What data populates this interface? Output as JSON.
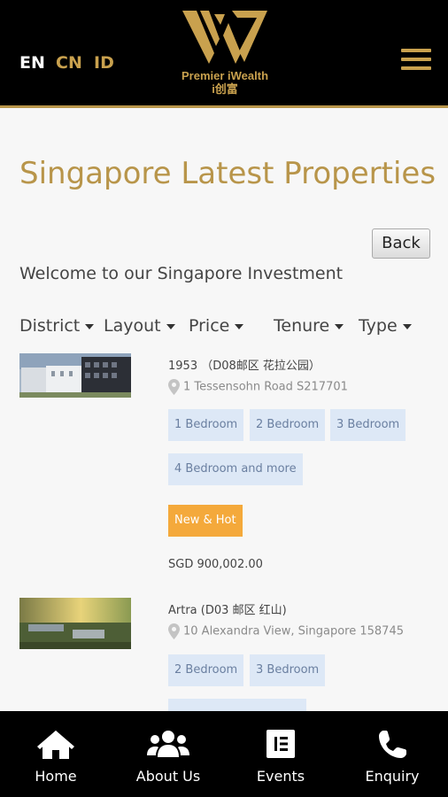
{
  "header": {
    "languages": [
      "EN",
      "CN",
      "ID"
    ],
    "logo_text": "Premier iWealth",
    "logo_sub": "i创富",
    "menu_icon": "hamburger-menu-icon"
  },
  "main": {
    "title": "Singapore Latest Properties",
    "back_label": "Back",
    "welcome": "Welcome to our Singapore Investment",
    "filters": [
      "District",
      "Layout",
      "Price",
      "Tenure",
      "Type"
    ]
  },
  "properties": [
    {
      "name": "1953 （D08邮区 花拉公园）",
      "address": "1 Tessensohn Road S217701",
      "layouts": [
        "1 Bedroom",
        "2 Bedroom",
        "3 Bedroom",
        "4 Bedroom and more"
      ],
      "badge": "New & Hot",
      "price": "SGD 900,002.00"
    },
    {
      "name": "Artra (D03 邮区 红山)",
      "address": "10 Alexandra View, Singapore 158745",
      "layouts": [
        "2 Bedroom",
        "3 Bedroom"
      ]
    }
  ],
  "bottom_nav": [
    {
      "label": "Home",
      "icon": "home-icon"
    },
    {
      "label": "About Us",
      "icon": "users-icon"
    },
    {
      "label": "Events",
      "icon": "events-icon"
    },
    {
      "label": "Enquiry",
      "icon": "phone-icon"
    }
  ],
  "colors": {
    "gold": "#c9a14e",
    "header_bg": "#000000",
    "tag_bg": "#dde8f6",
    "hot_badge": "#f4a93b"
  }
}
